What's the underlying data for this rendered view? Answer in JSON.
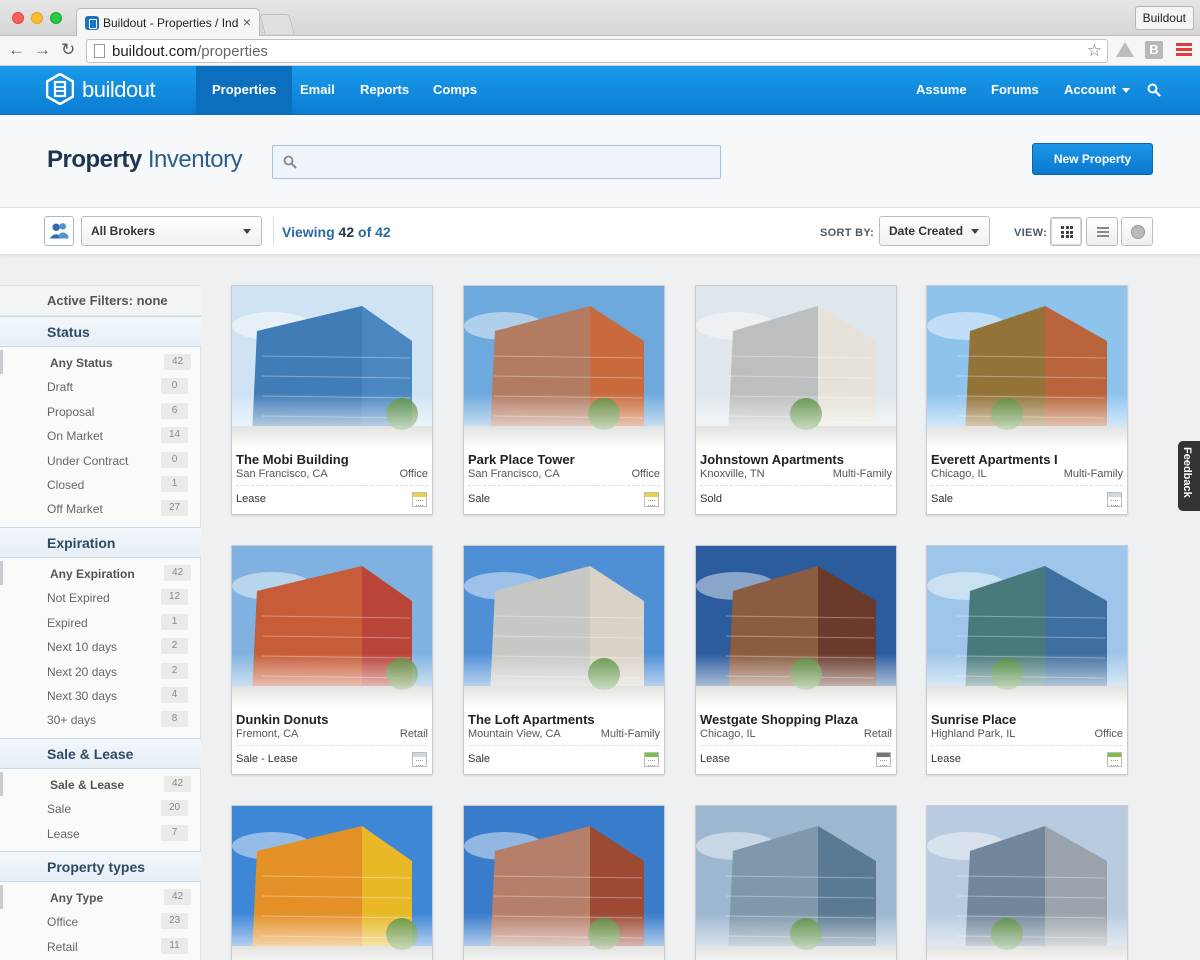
{
  "browser": {
    "tab_title": "Buildout - Properties / Inde",
    "url_host": "buildout.com",
    "url_path": "/properties",
    "profile_button": "Buildout",
    "ext_b_label": "B"
  },
  "appnav": {
    "logo_text": "buildout",
    "items_left": [
      "Properties",
      "Email",
      "Reports",
      "Comps"
    ],
    "active_item": "Properties",
    "items_right": [
      "Assume",
      "Forums",
      "Account"
    ]
  },
  "header": {
    "title_bold": "Property",
    "title_light": "Inventory",
    "search_placeholder": "",
    "new_button": "New Property"
  },
  "toolbar": {
    "broker_select": "All Brokers",
    "viewing_prefix": "Viewing",
    "viewing_count": "42",
    "viewing_of": "of",
    "viewing_total": "42",
    "sort_label": "SORT BY:",
    "sort_select": "Date Created",
    "view_label": "VIEW:"
  },
  "sidebar": {
    "active_filters": "Active Filters: none",
    "sections": [
      {
        "title": "Status",
        "rows": [
          {
            "label": "Any Status",
            "count": "42"
          },
          {
            "label": "Draft",
            "count": "0"
          },
          {
            "label": "Proposal",
            "count": "6"
          },
          {
            "label": "On Market",
            "count": "14"
          },
          {
            "label": "Under Contract",
            "count": "0"
          },
          {
            "label": "Closed",
            "count": "1"
          },
          {
            "label": "Off Market",
            "count": "27"
          }
        ]
      },
      {
        "title": "Expiration",
        "rows": [
          {
            "label": "Any Expiration",
            "count": "42"
          },
          {
            "label": "Not Expired",
            "count": "12"
          },
          {
            "label": "Expired",
            "count": "1"
          },
          {
            "label": "Next 10 days",
            "count": "2"
          },
          {
            "label": "Next 20 days",
            "count": "2"
          },
          {
            "label": "Next 30 days",
            "count": "4"
          },
          {
            "label": "30+ days",
            "count": "8"
          }
        ]
      },
      {
        "title": "Sale & Lease",
        "rows": [
          {
            "label": "Sale & Lease",
            "count": "42"
          },
          {
            "label": "Sale",
            "count": "20"
          },
          {
            "label": "Lease",
            "count": "7"
          }
        ]
      },
      {
        "title": "Property types",
        "rows": [
          {
            "label": "Any Type",
            "count": "42"
          },
          {
            "label": "Office",
            "count": "23"
          },
          {
            "label": "Retail",
            "count": "11"
          }
        ]
      }
    ]
  },
  "properties": [
    {
      "title": "The Mobi Building",
      "location": "San Francisco, CA",
      "type": "Office",
      "deal": "Lease",
      "cal": "yellow",
      "sky": "#cfe3f4",
      "bldg": "#4a86c0",
      "accent": "#2f6aa3"
    },
    {
      "title": "Park Place Tower",
      "location": "San Francisco, CA",
      "type": "Office",
      "deal": "Sale",
      "cal": "yellow",
      "sky": "#6ea9de",
      "bldg": "#c86a3c",
      "accent": "#8a9aa8"
    },
    {
      "title": "Johnstown Apartments",
      "location": "Knoxville, TN",
      "type": "Multi-Family",
      "deal": "Sold",
      "cal": "none",
      "sky": "#dfe6ec",
      "bldg": "#e6e2da",
      "accent": "#6c7f8c"
    },
    {
      "title": "Everett Apartments I",
      "location": "Chicago, IL",
      "type": "Multi-Family",
      "deal": "Sale",
      "cal": "plain",
      "sky": "#8ec3ee",
      "bldg": "#b9643a",
      "accent": "#4f8f3a"
    },
    {
      "title": "Dunkin Donuts",
      "location": "Fremont, CA",
      "type": "Retail",
      "deal": "Sale - Lease",
      "cal": "plain",
      "sky": "#7fb2e0",
      "bldg": "#b8443a",
      "accent": "#e38a3a"
    },
    {
      "title": "The Loft Apartments",
      "location": "Mountain View, CA",
      "type": "Multi-Family",
      "deal": "Sale",
      "cal": "green",
      "sky": "#4e8fd6",
      "bldg": "#d9d2c6",
      "accent": "#a7b4bf"
    },
    {
      "title": "Westgate Shopping Plaza",
      "location": "Chicago, IL",
      "type": "Retail",
      "deal": "Lease",
      "cal": "grey",
      "sky": "#2b5c9e",
      "bldg": "#6a3a2a",
      "accent": "#c8a06a"
    },
    {
      "title": "Sunrise Place",
      "location": "Highland Park, IL",
      "type": "Office",
      "deal": "Lease",
      "cal": "green",
      "sky": "#9ec6ea",
      "bldg": "#3f6f9f",
      "accent": "#5a8f3a"
    },
    {
      "title": "",
      "location": "",
      "type": "",
      "deal": "",
      "cal": "none",
      "sky": "#3e86d6",
      "bldg": "#e8b826",
      "accent": "#d9472b"
    },
    {
      "title": "",
      "location": "",
      "type": "",
      "deal": "",
      "cal": "none",
      "sky": "#3a7ccc",
      "bldg": "#9c4a34",
      "accent": "#e9e2d2"
    },
    {
      "title": "",
      "location": "",
      "type": "",
      "deal": "",
      "cal": "none",
      "sky": "#9db7cf",
      "bldg": "#5a7a94",
      "accent": "#c7d1d9"
    },
    {
      "title": "",
      "location": "",
      "type": "",
      "deal": "",
      "cal": "none",
      "sky": "#b9cbe0",
      "bldg": "#9aa3ab",
      "accent": "#2a5280"
    }
  ],
  "feedback_label": "Feedback",
  "colors": {
    "nav_blue": "#0b7dd3",
    "title_navy": "#1e3551",
    "link_blue": "#2a6aa3"
  },
  "icons": {
    "back": "←",
    "forward": "→",
    "reload": "↻",
    "star": "☆",
    "close": "×"
  }
}
